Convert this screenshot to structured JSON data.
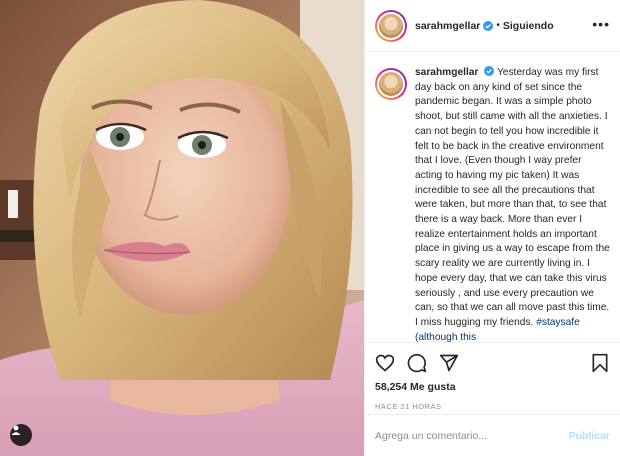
{
  "post": {
    "username": "sarahmgellar",
    "separator": "•",
    "follow_status": "Siguiendo",
    "more_label": "•••",
    "caption_text": "Yesterday was my first day back on any kind of set since the pandemic began. It was a simple photo shoot, but still came with all the anxieties. I can not begin to tell you how incredible it felt to be back in the creative environment that I love. (Even though I way prefer acting to having my pic taken) It was incredible to see all the precautions that were taken, but more than that, to see that there is a way back. More than ever I realize entertainment holds an important place in giving us a way to escape from the scary reality we are currently living in. I hope every day, that we can take this virus seriously , and use every precaution we can, so that we can all move past this time. I miss hugging my friends.",
    "caption_hashtag": "#staysafe",
    "caption_tail": "(although this",
    "likes": "58,254 Me gusta",
    "time_ago": "HACE 21 HORAS",
    "comment_placeholder": "Agrega un comentario...",
    "publish_label": "Publicar"
  },
  "colors": {
    "link": "#00376b",
    "publish_disabled": "#b2dffc",
    "verified": "#3897f0"
  },
  "icons": [
    "heart-icon",
    "comment-icon",
    "share-icon",
    "bookmark-icon",
    "user-tag-icon",
    "verified-badge-icon"
  ]
}
